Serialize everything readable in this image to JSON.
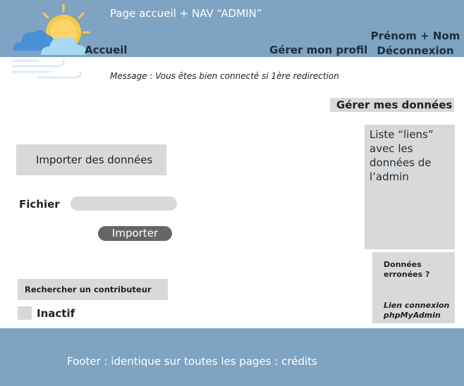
{
  "header": {
    "title": "Page accueil + NAV “ADMIN”",
    "nav": {
      "home": "Accueil",
      "profile": "Gérer mon profil",
      "user_name": "Prénom + Nom",
      "logout": "Déconnexion"
    },
    "logo_icon": "sun-cloud-wind-icon",
    "color": "#7fa3c2"
  },
  "main": {
    "message": "Message : Vous êtes bien connecté si 1ère redirection",
    "manage_data_label": "Gérer mes données",
    "links_panel_text": "Liste “liens” avec les données de l’admin",
    "import_section_title": "Importer des données",
    "file_label": "Fichier",
    "import_button": "Importer",
    "error_box": {
      "question": "Données erronées ?",
      "link": "Lien connexion phpMyAdmin"
    },
    "search_contributor_label": "Rechercher un contributeur",
    "inactive_label": "Inactif"
  },
  "footer": {
    "text": "Footer : identique sur toutes les pages : crédits"
  }
}
